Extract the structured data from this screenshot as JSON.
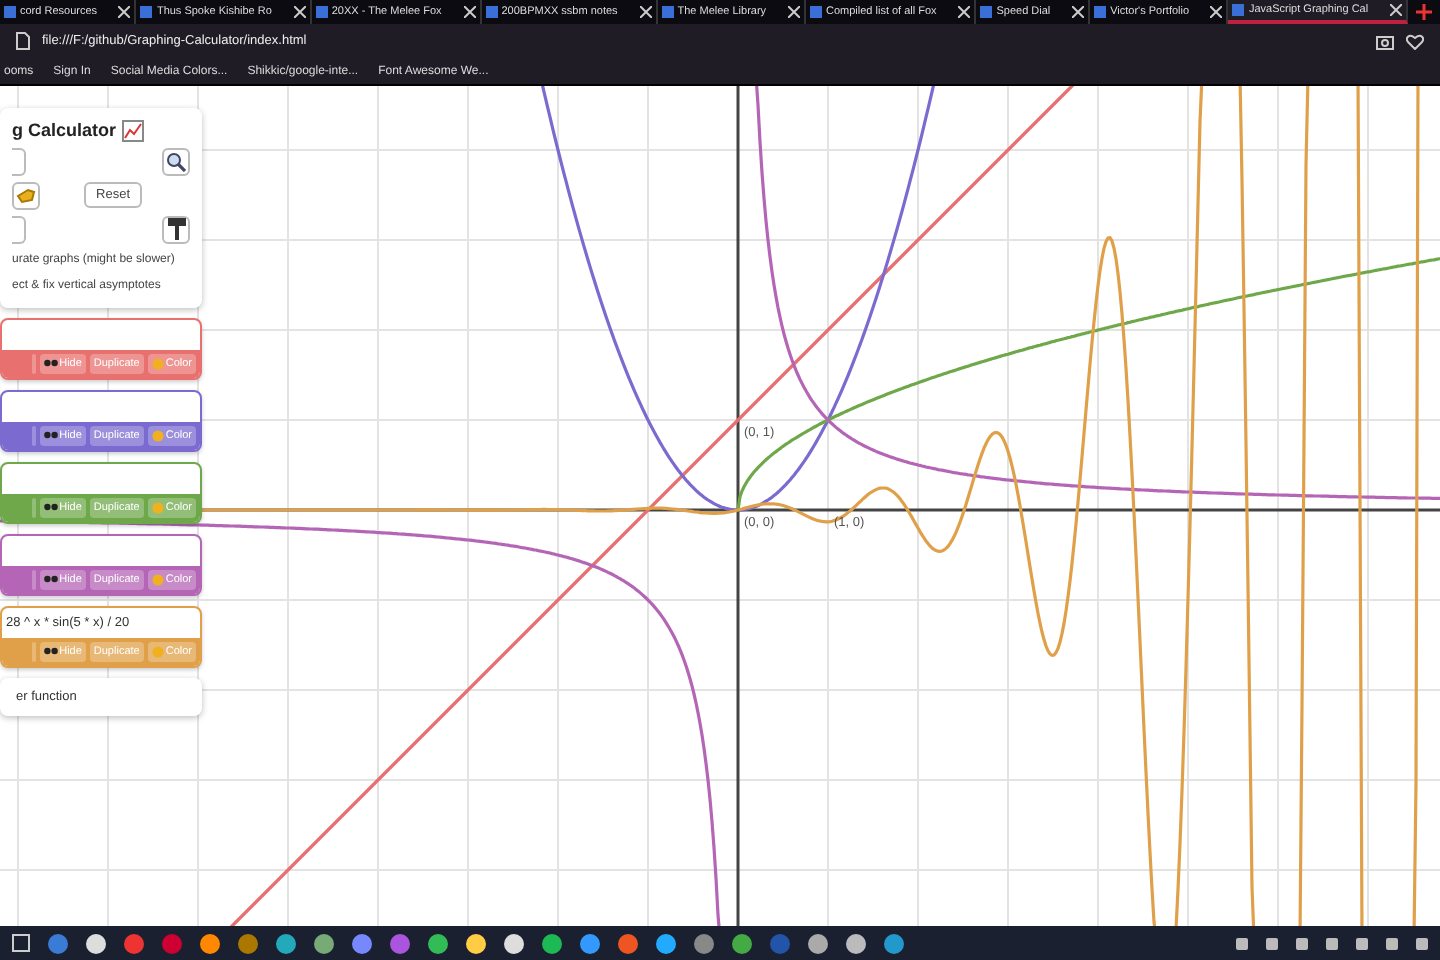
{
  "tabs": [
    {
      "title": "cord Resources",
      "selected": false
    },
    {
      "title": "Thus Spoke Kishibe Ro",
      "selected": false
    },
    {
      "title": "20XX - The Melee Fox",
      "selected": false
    },
    {
      "title": "200BPMXX ssbm notes",
      "selected": false
    },
    {
      "title": "The Melee Library",
      "selected": false
    },
    {
      "title": "Compiled list of all Fox",
      "selected": false
    },
    {
      "title": "Speed Dial",
      "selected": false
    },
    {
      "title": "Victor's Portfolio",
      "selected": false
    },
    {
      "title": "JavaScript Graphing Cal",
      "selected": true
    }
  ],
  "url": "file:///F:/github/Graphing-Calculator/index.html",
  "bookmarks": [
    "ooms",
    "Sign In",
    "Social Media Colors...",
    "Shikkic/google-inte...",
    "Font Awesome We..."
  ],
  "panel": {
    "title": "g Calculator",
    "reset": "Reset",
    "options": [
      "urate graphs (might be slower)",
      "ect & fix vertical asymptotes"
    ]
  },
  "functions": [
    {
      "kind": "line",
      "color": "#e8716f",
      "buttons": [
        "Hide",
        "Duplicate",
        "Color"
      ]
    },
    {
      "kind": "parabola",
      "color": "#7b6bd0",
      "buttons": [
        "Hide",
        "Duplicate",
        "Color"
      ]
    },
    {
      "kind": "sqrt",
      "color": "#6fa84a",
      "buttons": [
        "Hide",
        "Duplicate",
        "Color"
      ]
    },
    {
      "kind": "reciprocal",
      "color": "#b565b5",
      "buttons": [
        "Hide",
        "Duplicate",
        "Color"
      ]
    },
    {
      "kind": "wave",
      "expression": "28 ^ x * sin(5 * x) / 20",
      "color": "#e0a04a",
      "buttons": [
        "Hide",
        "Duplicate",
        "Color"
      ]
    }
  ],
  "add_function": "er function",
  "points": [
    "(0, 1)",
    "(0, 0)",
    "(1, 0)"
  ]
}
